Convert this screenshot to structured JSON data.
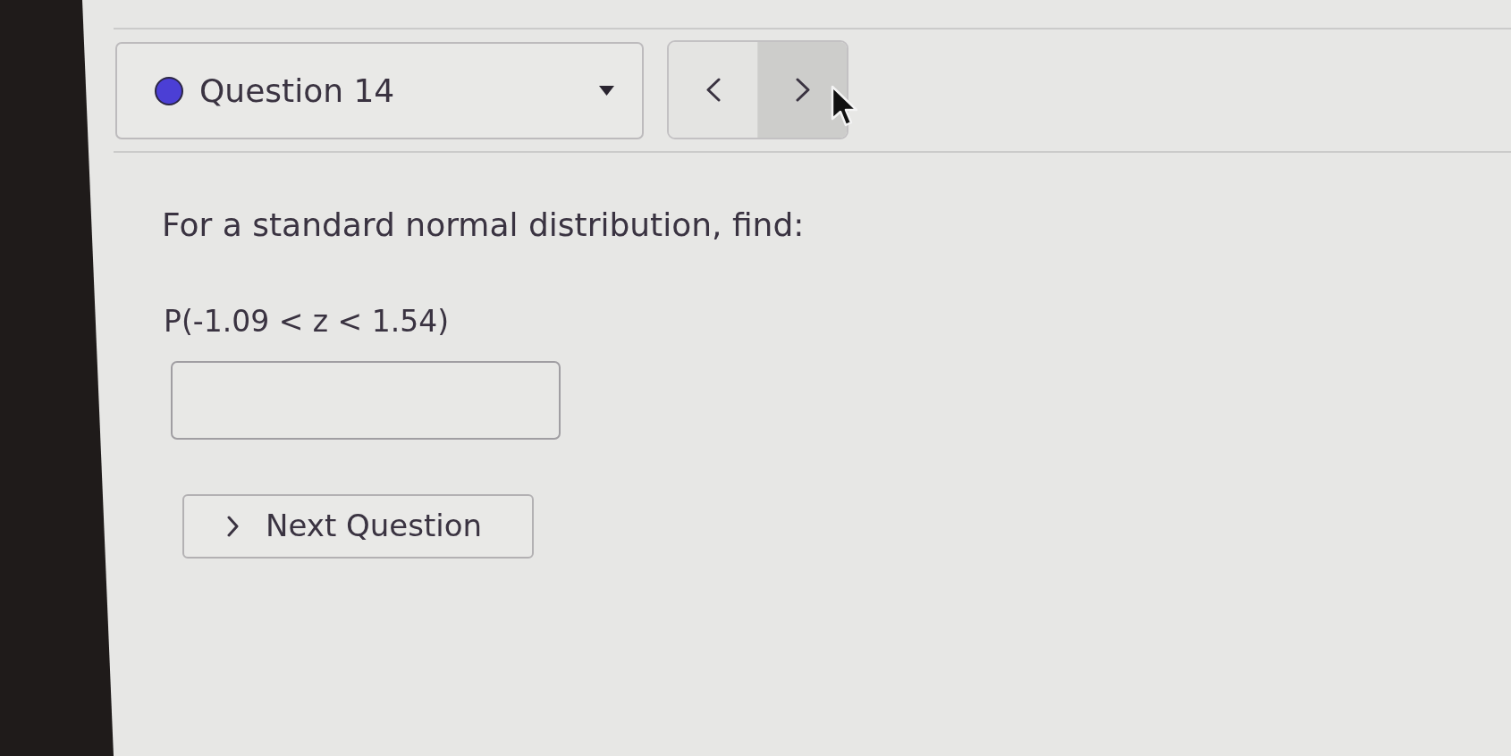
{
  "question_selector": {
    "label": "Question 14"
  },
  "nav_buttons": [
    {
      "kind": "previous",
      "hovered": false
    },
    {
      "kind": "next",
      "hovered": true
    }
  ],
  "question": {
    "prompt": "For a standard normal distribution, find:",
    "expression": "P(-1.09 < z < 1.54)"
  },
  "next_button": {
    "label": "Next Question"
  }
}
